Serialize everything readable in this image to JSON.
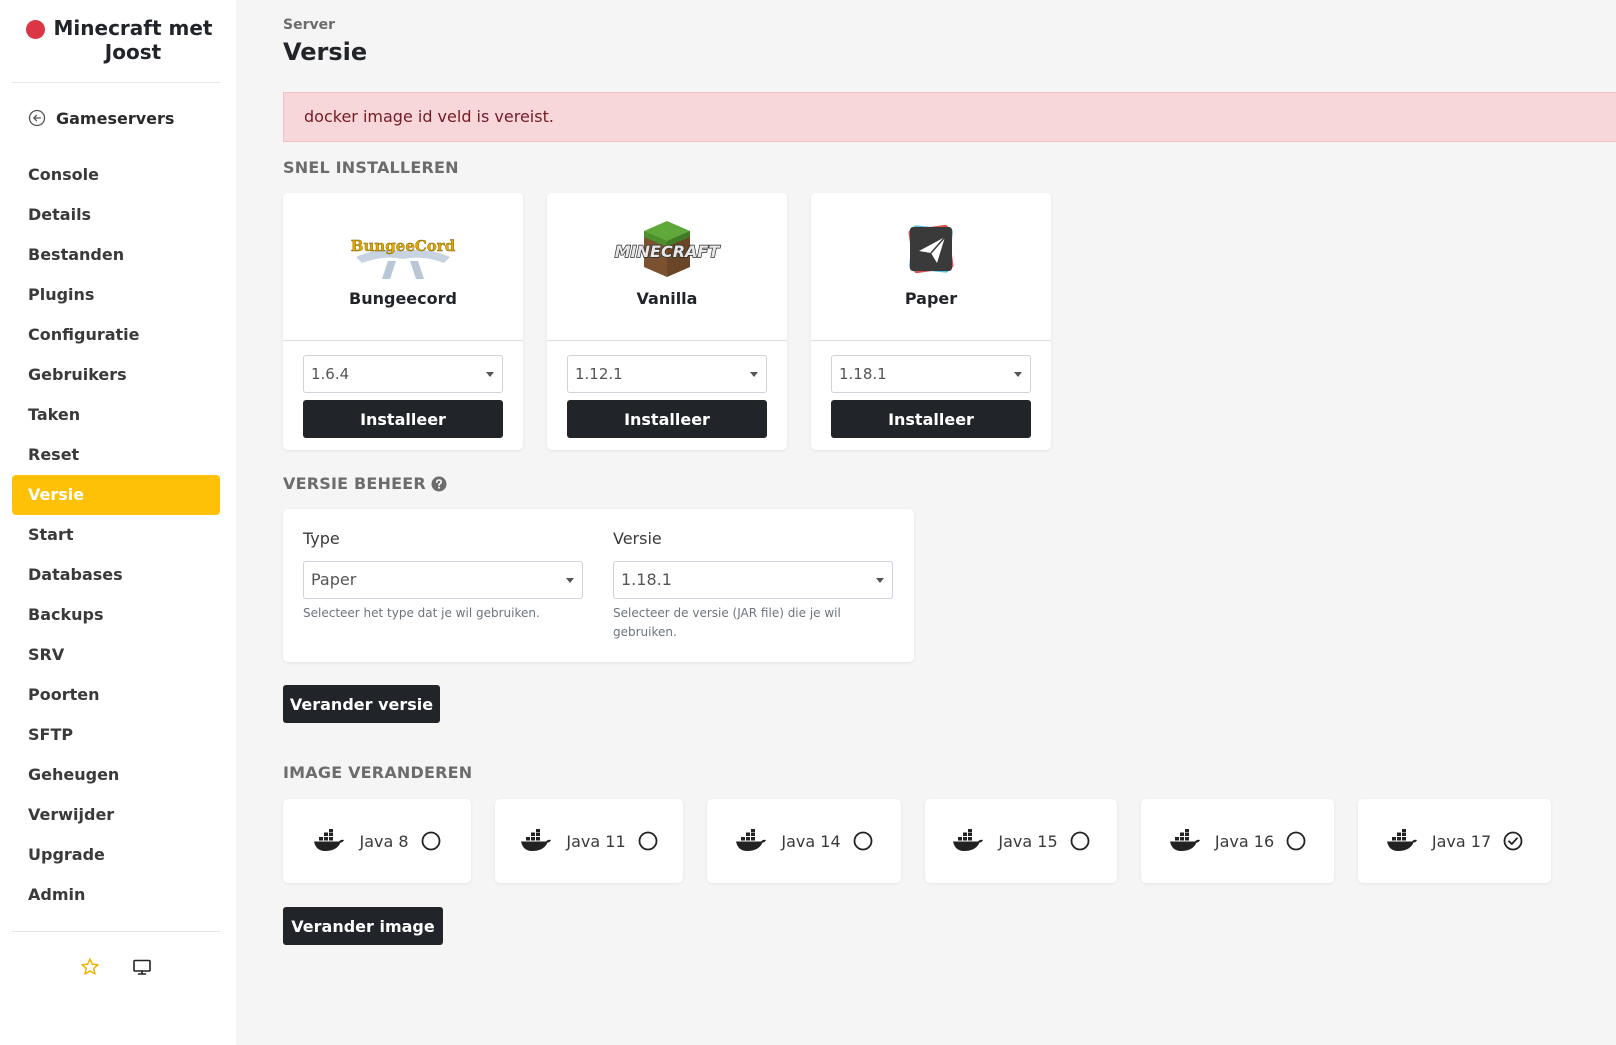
{
  "sidebar": {
    "server_name": "Minecraft met Joost",
    "status_color": "#dc3545",
    "back_label": "Gameservers",
    "items": [
      {
        "label": "Console",
        "active": false
      },
      {
        "label": "Details",
        "active": false
      },
      {
        "label": "Bestanden",
        "active": false
      },
      {
        "label": "Plugins",
        "active": false
      },
      {
        "label": "Configuratie",
        "active": false
      },
      {
        "label": "Gebruikers",
        "active": false
      },
      {
        "label": "Taken",
        "active": false
      },
      {
        "label": "Reset",
        "active": false
      },
      {
        "label": "Versie",
        "active": true
      },
      {
        "label": "Start",
        "active": false
      },
      {
        "label": "Databases",
        "active": false
      },
      {
        "label": "Backups",
        "active": false
      },
      {
        "label": "SRV",
        "active": false
      },
      {
        "label": "Poorten",
        "active": false
      },
      {
        "label": "SFTP",
        "active": false
      },
      {
        "label": "Geheugen",
        "active": false
      },
      {
        "label": "Verwijder",
        "active": false
      },
      {
        "label": "Upgrade",
        "active": false
      },
      {
        "label": "Admin",
        "active": false
      }
    ],
    "footer_icons": [
      "star-icon",
      "monitor-icon"
    ]
  },
  "header": {
    "breadcrumb": "Server",
    "title": "Versie"
  },
  "alert": {
    "message": "docker image id veld is vereist."
  },
  "quick_install": {
    "title": "SNEL INSTALLEREN",
    "cards": [
      {
        "name": "Bungeecord",
        "logo_text": "BungeeCord",
        "version": "1.6.4",
        "button": "Installeer"
      },
      {
        "name": "Vanilla",
        "logo_text": "MINECRAFT",
        "version": "1.12.1",
        "button": "Installeer"
      },
      {
        "name": "Paper",
        "logo_text": "",
        "version": "1.18.1",
        "button": "Installeer"
      }
    ]
  },
  "version_management": {
    "title": "VERSIE BEHEER",
    "type_label": "Type",
    "type_value": "Paper",
    "type_help": "Selecteer het type dat je wil gebruiken.",
    "version_label": "Versie",
    "version_value": "1.18.1",
    "version_help": "Selecteer de versie (JAR file) die je wil gebruiken.",
    "button": "Verander versie"
  },
  "image_change": {
    "title": "IMAGE VERANDEREN",
    "options": [
      {
        "label": "Java 8",
        "selected": false
      },
      {
        "label": "Java 11",
        "selected": false
      },
      {
        "label": "Java 14",
        "selected": false
      },
      {
        "label": "Java 15",
        "selected": false
      },
      {
        "label": "Java 16",
        "selected": false
      },
      {
        "label": "Java 17",
        "selected": true
      }
    ],
    "button": "Verander image"
  },
  "colors": {
    "accent": "#ffc107",
    "dark_button": "#212529",
    "alert_bg": "#f8d7da",
    "alert_text": "#721c24"
  }
}
